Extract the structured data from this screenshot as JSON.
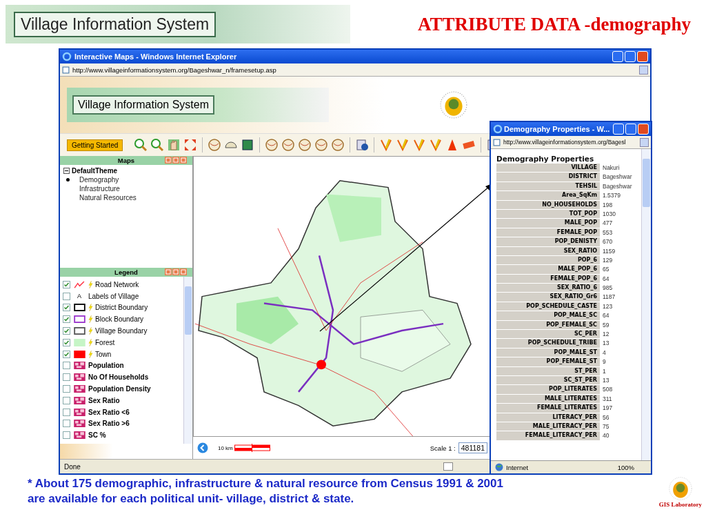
{
  "slide": {
    "banner_title": "Village Information System",
    "title": "ATTRIBUTE DATA -demography",
    "footnote": "* About 175 demographic, infrastructure & natural resource  from Census 1991 & 2001\nare available for each political unit- village, district & state.",
    "lab_label": "GIS Laboratory"
  },
  "window": {
    "title": "Interactive Maps - Windows Internet Explorer",
    "address": "http://www.villageinformationsystem.org/Bageshwar_n/framesetup.asp",
    "site_title": "Village Information System",
    "getting_started": "Getting Started",
    "status": "Done"
  },
  "maps_panel": {
    "title": "Maps",
    "theme": "DefaultTheme",
    "expanded": true,
    "children": [
      {
        "label": "Demography",
        "selected": true
      },
      {
        "label": "Infrastructure",
        "selected": false
      },
      {
        "label": "Natural Resources",
        "selected": false
      }
    ]
  },
  "legend": {
    "title": "Legend",
    "items": [
      {
        "kind": "line",
        "label": "Road Network",
        "checked": true,
        "bolt": true,
        "color": "#ff3344"
      },
      {
        "kind": "text",
        "label": "Labels of Village",
        "checked": false,
        "bolt": false,
        "symbol": "A"
      },
      {
        "kind": "box",
        "label": "District Boundary",
        "checked": true,
        "bolt": true,
        "color": "#000000"
      },
      {
        "kind": "box",
        "label": "Block Boundary",
        "checked": true,
        "bolt": true,
        "color": "#9933cc"
      },
      {
        "kind": "box",
        "label": "Village Boundary",
        "checked": true,
        "bolt": true,
        "color": "#555555"
      },
      {
        "kind": "fill",
        "label": "Forest",
        "checked": true,
        "bolt": true,
        "color": "#c6f5c6"
      },
      {
        "kind": "fill",
        "label": "Town",
        "checked": true,
        "bolt": true,
        "color": "#ff0000"
      },
      {
        "kind": "theme",
        "label": "Population",
        "checked": false,
        "bolt": false
      },
      {
        "kind": "theme",
        "label": "No Of Households",
        "checked": false,
        "bolt": false
      },
      {
        "kind": "theme",
        "label": "Population Density",
        "checked": false,
        "bolt": false
      },
      {
        "kind": "theme",
        "label": "Sex Ratio",
        "checked": false,
        "bolt": false
      },
      {
        "kind": "theme",
        "label": "Sex Ratio <6",
        "checked": false,
        "bolt": false
      },
      {
        "kind": "theme",
        "label": "Sex Ratio >6",
        "checked": false,
        "bolt": false
      },
      {
        "kind": "theme",
        "label": "SC %",
        "checked": false,
        "bolt": false
      }
    ]
  },
  "map": {
    "scale_label": "10 km",
    "scale_prefix": "Scale  1 :",
    "scale_value": "481181"
  },
  "popup": {
    "title": "Demography Properties - W...",
    "address": "http://www.villageinformationsystem.org/Bagesl",
    "heading": "Demography Properties",
    "zone": "Internet",
    "zoom": "100%",
    "rows": [
      {
        "label": "VILLAGE",
        "value": "Nakuri"
      },
      {
        "label": "DISTRICT",
        "value": "Bageshwar"
      },
      {
        "label": "TEHSIL",
        "value": "Bageshwar"
      },
      {
        "label": "Area_SqKm",
        "value": "1.5379"
      },
      {
        "label": "NO_HOUSEHOLDS",
        "value": "198"
      },
      {
        "label": "TOT_POP",
        "value": "1030"
      },
      {
        "label": "MALE_POP",
        "value": "477"
      },
      {
        "label": "FEMALE_POP",
        "value": "553"
      },
      {
        "label": "POP_DENISTY",
        "value": "670"
      },
      {
        "label": "SEX_RATIO",
        "value": "1159"
      },
      {
        "label": "POP_6",
        "value": "129"
      },
      {
        "label": "MALE_POP_6",
        "value": "65"
      },
      {
        "label": "FEMALE_POP_6",
        "value": "64"
      },
      {
        "label": "SEX_RATIO_6",
        "value": "985"
      },
      {
        "label": "SEX_RATIO_Gr6",
        "value": "1187"
      },
      {
        "label": "POP_SCHEDULE_CASTE",
        "value": "123"
      },
      {
        "label": "POP_MALE_SC",
        "value": "64"
      },
      {
        "label": "POP_FEMALE_SC",
        "value": "59"
      },
      {
        "label": "SC_PER",
        "value": "12"
      },
      {
        "label": "POP_SCHEDULE_TRIBE",
        "value": "13"
      },
      {
        "label": "POP_MALE_ST",
        "value": "4"
      },
      {
        "label": "POP_FEMALE_ST",
        "value": "9"
      },
      {
        "label": "ST_PER",
        "value": "1"
      },
      {
        "label": "SC_ST_PER",
        "value": "13"
      },
      {
        "label": "POP_LITERATES",
        "value": "508"
      },
      {
        "label": "MALE_LITERATES",
        "value": "311"
      },
      {
        "label": "FEMALE_LITERATES",
        "value": "197"
      },
      {
        "label": "LITERACY_PER",
        "value": "56"
      },
      {
        "label": "MALE_LITERACY_PER",
        "value": "75"
      },
      {
        "label": "FEMALE_LITERACY_PER",
        "value": "40"
      }
    ]
  }
}
